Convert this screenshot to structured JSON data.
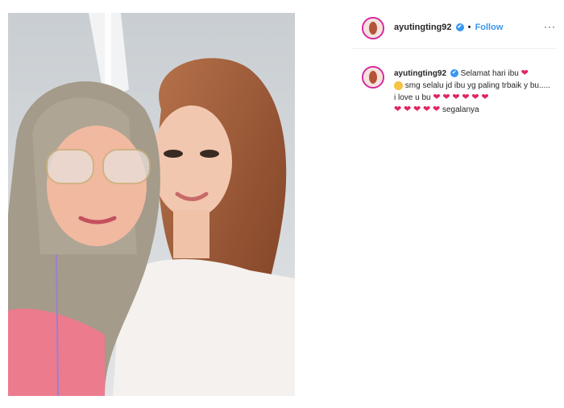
{
  "post": {
    "username": "ayutingting92",
    "follow_label": "Follow",
    "separator": "•",
    "more_label": "···",
    "verified_mark": "✔",
    "caption": {
      "line1": "Selamat hari ibu",
      "line2": "smg selalu jd ibu yg paling trbaik",
      "line3": "y bu..... i love u bu",
      "line4": "segalanya",
      "heart": "❤",
      "emoji": "😘"
    }
  },
  "colors": {
    "accent": "#3897f0",
    "heart": "#e0245e",
    "avatar_ring": "#d6249f"
  }
}
